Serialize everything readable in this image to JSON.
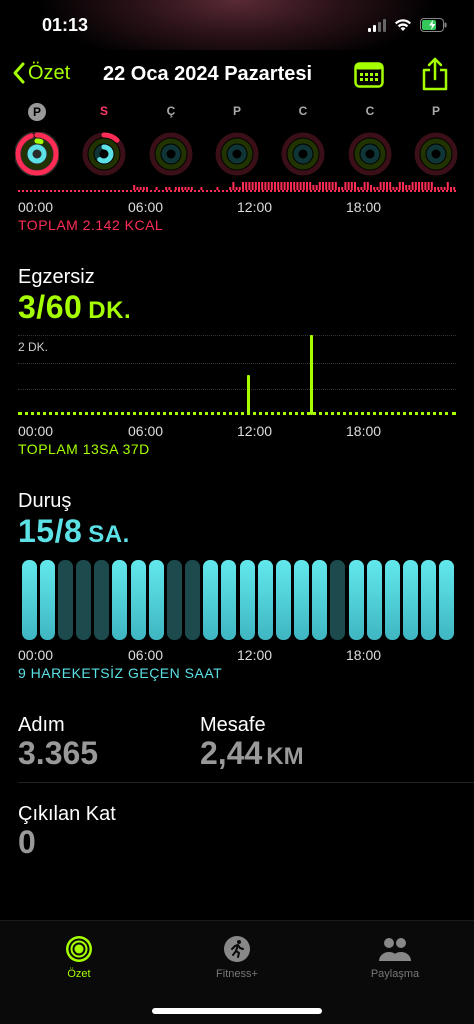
{
  "status_bar": {
    "time": "01:13"
  },
  "nav": {
    "back_label": "Özet",
    "title": "22 Oca 2024 Pazartesi"
  },
  "week": [
    {
      "letter": "P",
      "today": true,
      "move": 0.95,
      "exercise": 0.05,
      "stand": 1.0
    },
    {
      "letter": "S",
      "sunday": true,
      "move": 0.12,
      "exercise": 0.0,
      "stand": 0.6
    },
    {
      "letter": "Ç",
      "move": 0.0,
      "exercise": 0.0,
      "stand": 0.0
    },
    {
      "letter": "P",
      "move": 0.0,
      "exercise": 0.0,
      "stand": 0.0
    },
    {
      "letter": "C",
      "move": 0.0,
      "exercise": 0.0,
      "stand": 0.0
    },
    {
      "letter": "C",
      "move": 0.0,
      "exercise": 0.0,
      "stand": 0.0
    },
    {
      "letter": "P",
      "move": 0.0,
      "exercise": 0.0,
      "stand": 0.0
    }
  ],
  "axis_labels": [
    "00:00",
    "06:00",
    "12:00",
    "18:00"
  ],
  "move": {
    "total": "TOPLAM 2.142 KCAL",
    "color": "#ff2d55"
  },
  "exercise": {
    "title": "Egzersiz",
    "value": "3/60",
    "unit": "DK.",
    "gridline_label": "2 DK.",
    "total": "TOPLAM 13SA 37D",
    "color": "#a6ff00"
  },
  "stand": {
    "title": "Duruş",
    "value": "15/8",
    "unit": "SA.",
    "summary": "9 HAREKETSİZ GEÇEN SAAT",
    "color": "#5ce1e6",
    "hours": [
      1,
      1,
      0,
      0,
      0,
      1,
      1,
      1,
      0,
      0,
      1,
      1,
      1,
      1,
      1,
      1,
      1,
      0,
      1,
      1,
      1,
      1,
      1,
      1
    ]
  },
  "stats": {
    "steps_label": "Adım",
    "steps_value": "3.365",
    "distance_label": "Mesafe",
    "distance_value": "2,44",
    "distance_unit": "KM",
    "floors_label": "Çıkılan Kat",
    "floors_value": "0"
  },
  "tabs": [
    {
      "label": "Özet",
      "icon": "activity-rings-icon",
      "active": true
    },
    {
      "label": "Fitness+",
      "icon": "running-figure-icon",
      "active": false
    },
    {
      "label": "Paylaşma",
      "icon": "people-icon",
      "active": false
    }
  ],
  "chart_data": [
    {
      "type": "bar",
      "title": "Egzersiz",
      "x": [
        "00:00",
        "06:00",
        "12:00",
        "18:00"
      ],
      "series": [
        {
          "values": [
            {
              "x": "12:00",
              "y": 1
            },
            {
              "x": "15:00",
              "y": 2
            }
          ]
        }
      ],
      "ylabel": "",
      "gridline": "2 DK."
    },
    {
      "type": "bar",
      "title": "Duruş",
      "x": [
        "00:00",
        "06:00",
        "12:00",
        "18:00"
      ],
      "series": [
        {
          "values": [
            1,
            1,
            0,
            0,
            0,
            1,
            1,
            1,
            0,
            0,
            1,
            1,
            1,
            1,
            1,
            1,
            1,
            0,
            1,
            1,
            1,
            1,
            1,
            1
          ]
        }
      ]
    }
  ]
}
